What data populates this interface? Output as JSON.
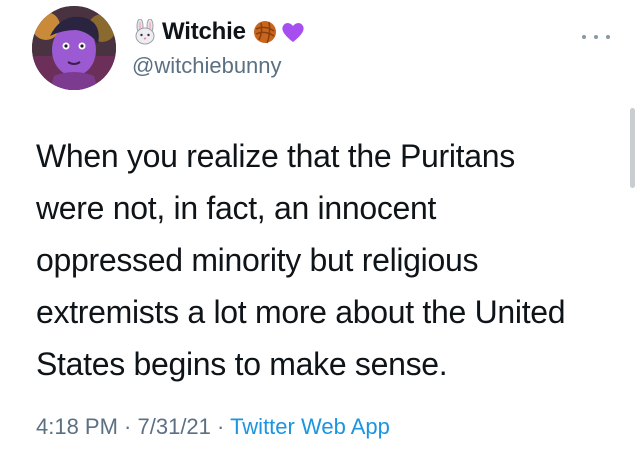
{
  "author": {
    "display_name": "Witchie",
    "handle": "@witchiebunny",
    "name_emojis": [
      "rabbit-face-icon",
      "yarn-ball-icon",
      "purple-heart-icon"
    ]
  },
  "tweet": {
    "text_lines": [
      "When you realize that the Puritans",
      "were not, in fact, an innocent",
      "oppressed minority but religious",
      "extremists a lot more about the United",
      "States begins to make sense."
    ]
  },
  "meta": {
    "time": "4:18 PM",
    "separator": " · ",
    "date": "7/31/21",
    "source": "Twitter Web App"
  },
  "colors": {
    "text": "#0f1419",
    "secondary": "#5b7083",
    "link": "#1b95e0",
    "heart": "#a64ef0",
    "yarn": "#c7661c"
  }
}
